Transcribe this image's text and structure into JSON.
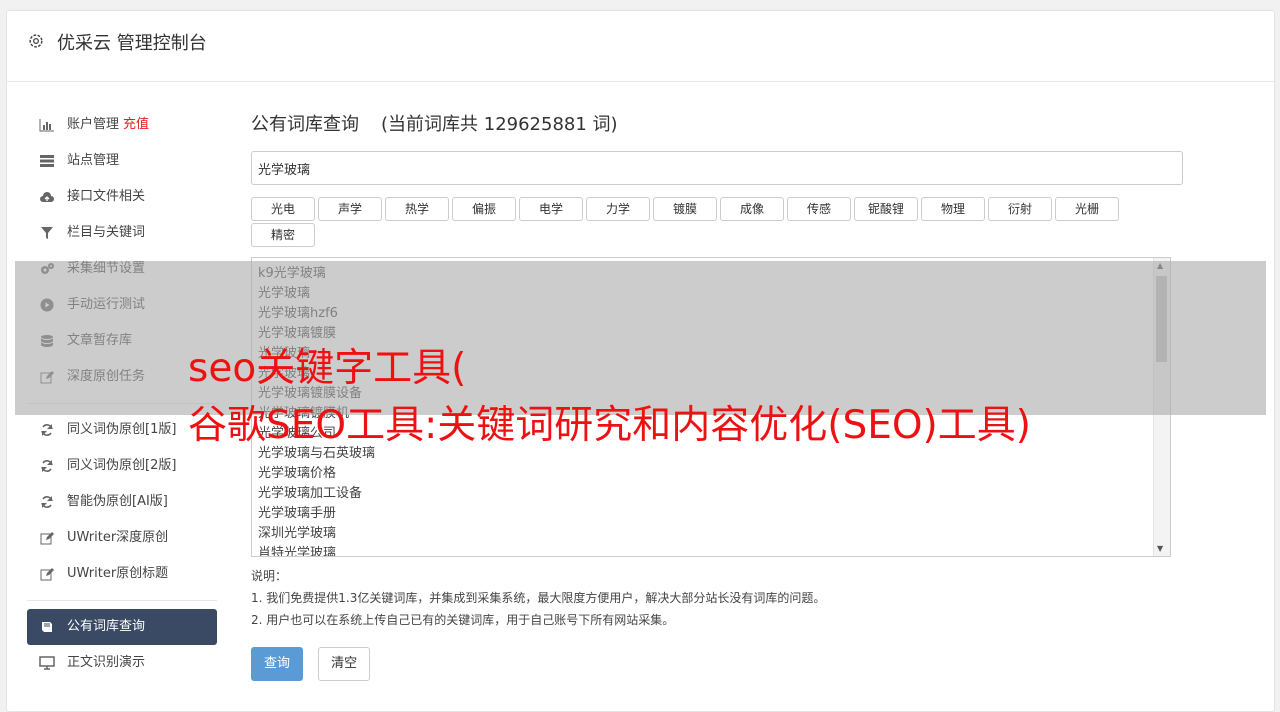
{
  "header": {
    "title": "优采云 管理控制台"
  },
  "sidebar": {
    "group1": [
      {
        "label": "账户管理",
        "tag": "充值",
        "icon": "bar-chart-icon"
      },
      {
        "label": "站点管理",
        "icon": "server-icon"
      },
      {
        "label": "接口文件相关",
        "icon": "cloud-upload-icon"
      },
      {
        "label": "栏目与关键词",
        "icon": "filter-icon"
      },
      {
        "label": "采集细节设置",
        "icon": "cogs-icon"
      },
      {
        "label": "手动运行测试",
        "icon": "play-circle-icon"
      },
      {
        "label": "文章暂存库",
        "icon": "database-icon"
      },
      {
        "label": "深度原创任务",
        "icon": "edit-icon"
      }
    ],
    "group2": [
      {
        "label": "同义词伪原创[1版]",
        "icon": "refresh-icon"
      },
      {
        "label": "同义词伪原创[2版]",
        "icon": "refresh-icon"
      },
      {
        "label": "智能伪原创[AI版]",
        "icon": "refresh-icon"
      },
      {
        "label": "UWriter深度原创",
        "icon": "edit-icon"
      },
      {
        "label": "UWriter原创标题",
        "icon": "edit-icon"
      }
    ],
    "active": {
      "label": "公有词库查询",
      "icon": "book-icon"
    },
    "group3": [
      {
        "label": "正文识别演示",
        "icon": "monitor-icon"
      }
    ]
  },
  "main": {
    "title": "公有词库查询",
    "count_text": "(当前词库共 129625881 词)",
    "search_value": "光学玻璃",
    "tags": [
      "光电",
      "声学",
      "热学",
      "偏振",
      "电学",
      "力学",
      "镀膜",
      "成像",
      "传感",
      "铌酸锂",
      "物理",
      "衍射",
      "光栅",
      "精密"
    ],
    "results": [
      "k9光学玻璃",
      "光学玻璃",
      "光学玻璃hzf6",
      "光学玻璃镀膜",
      "光学玻璃",
      "光学玻璃",
      "光学玻璃镀膜设备",
      "光学玻璃镀膜机",
      "光学玻璃公司",
      "光学玻璃与石英玻璃",
      "光学玻璃价格",
      "光学玻璃加工设备",
      "光学玻璃手册",
      "深圳光学玻璃",
      "肖特光学玻璃"
    ],
    "notes_title": "说明：",
    "notes": [
      "1. 我们免费提供1.3亿关键词库，并集成到采集系统，最大限度方便用户，解决大部分站长没有词库的问题。",
      "2. 用户也可以在系统上传自己已有的关键词库，用于自己账号下所有网站采集。"
    ],
    "query_label": "查询",
    "clear_label": "清空"
  },
  "overlay": {
    "line1": "seo关键字工具(",
    "line2": "谷歌SEO工具:关键词研究和内容优化(SEO)工具)"
  }
}
